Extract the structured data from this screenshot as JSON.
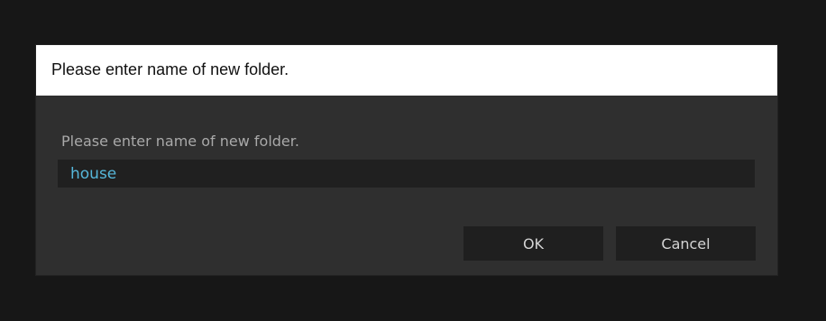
{
  "dialog": {
    "title": "Please enter name of new folder.",
    "prompt": "Please enter name of new folder.",
    "folder_name_value": "house",
    "ok_label": "OK",
    "cancel_label": "Cancel"
  },
  "colors": {
    "backdrop": "#171717",
    "dialog_body": "#2f2f2f",
    "titlebar": "#ffffff",
    "input_background": "#202020",
    "input_text": "#56b7da",
    "button_background": "#1f1f1f"
  }
}
